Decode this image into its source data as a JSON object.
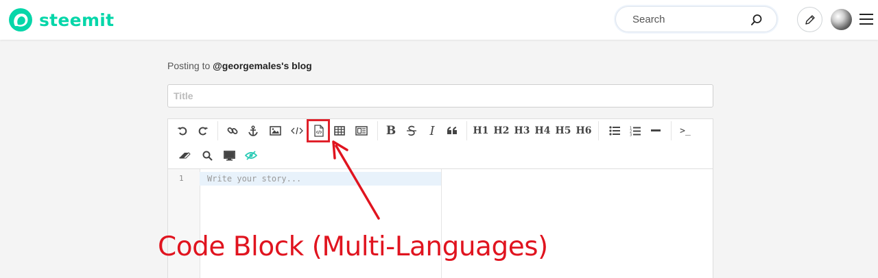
{
  "header": {
    "brand": "steemit",
    "brand_color": "#06d6a9",
    "search_placeholder": "Search",
    "icons": [
      "steemit-logo-icon",
      "search-icon",
      "pencil-icon",
      "avatar",
      "hamburger-menu-icon"
    ]
  },
  "editor": {
    "posting_prefix": "Posting to ",
    "posting_target": "@georgemales's blog",
    "title_placeholder": "Title",
    "toolbar": {
      "buttons": [
        "undo",
        "redo",
        "link",
        "anchor",
        "image",
        "inline-code",
        "code-block",
        "table",
        "table-alt",
        "bold",
        "strikethrough",
        "italic",
        "quote",
        "h1",
        "h2",
        "h3",
        "h4",
        "h5",
        "h6",
        "bullet-list",
        "numbered-list",
        "horizontal-rule",
        "terminal",
        "eraser",
        "search",
        "preview",
        "toggle-visibility"
      ],
      "h1": "H1",
      "h2": "H2",
      "h3": "H3",
      "h4": "H4",
      "h5": "H5",
      "h6": "H6",
      "bold": "B",
      "italic": "I",
      "terminal": ">_"
    },
    "line_number": "1",
    "body_placeholder": "Write your story..."
  },
  "annotation": {
    "text": "Code Block (Multi-Languages)",
    "color": "#e0141f"
  }
}
